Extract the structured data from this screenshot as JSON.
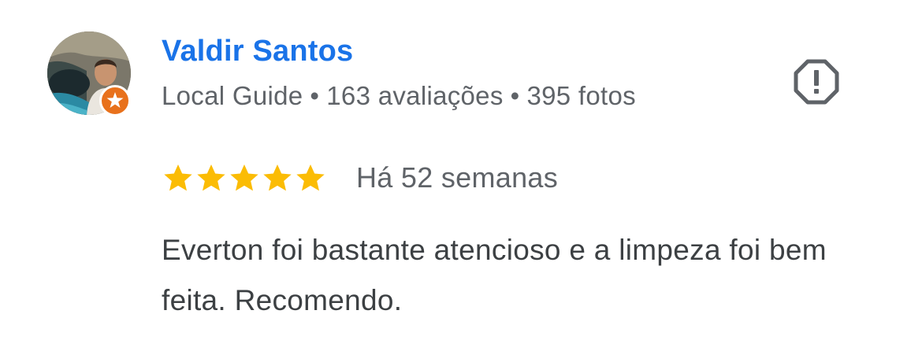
{
  "review": {
    "reviewer": {
      "name": "Valdir Santos",
      "badge": "Local Guide",
      "separator": "•",
      "reviews_count": "163 avaliações",
      "photos_count": "395 fotos",
      "avatar_icon": "user-photo",
      "badge_icon": "local-guide-star-icon"
    },
    "report_icon": "report-octagon-icon",
    "rating": {
      "value": 5,
      "max": 5,
      "star_color": "#fbbc04"
    },
    "date": "Há 52 semanas",
    "text": "Everton foi bastante atencioso e a limpeza foi bem feita. Recomendo."
  },
  "colors": {
    "name": "#1a73e8",
    "meta": "#5f6368",
    "body_text": "#3c4043",
    "badge": "#e8711c"
  }
}
